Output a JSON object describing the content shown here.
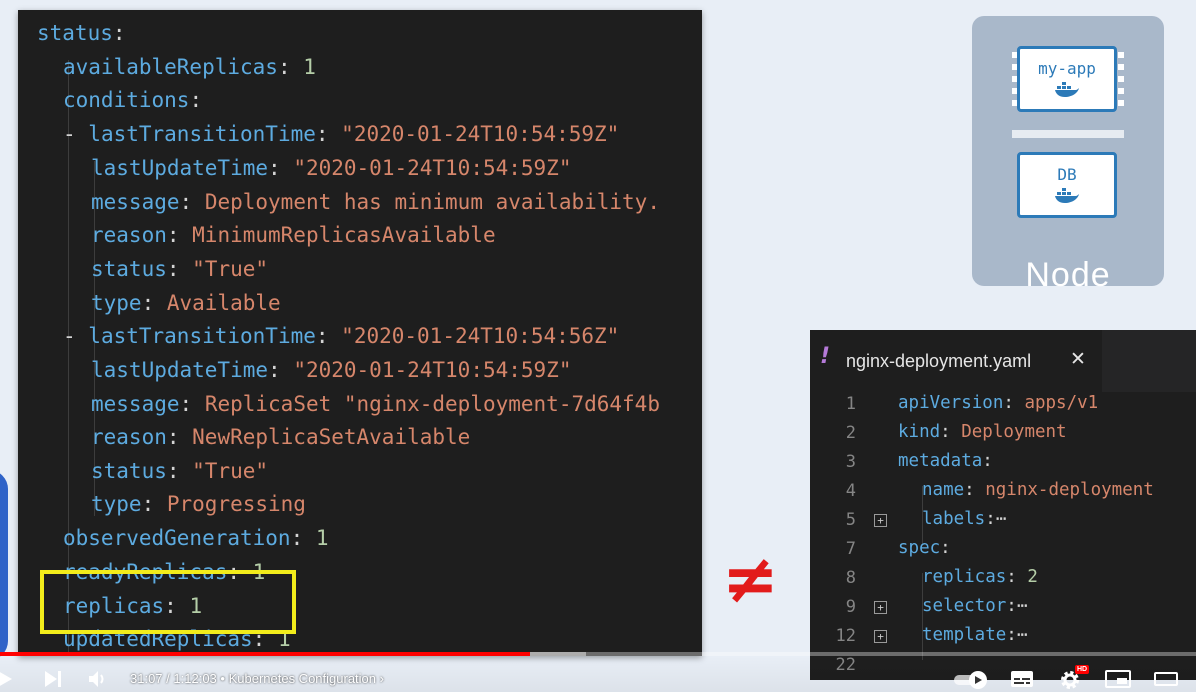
{
  "left_editor": {
    "lines": [
      {
        "t": [
          [
            "k",
            "status"
          ],
          [
            "p",
            ":"
          ]
        ]
      },
      {
        "t": [
          [
            "k",
            "availableReplicas"
          ],
          [
            "p",
            ": "
          ],
          [
            "n",
            "1"
          ]
        ]
      },
      {
        "t": [
          [
            "k",
            "conditions"
          ],
          [
            "p",
            ":"
          ]
        ]
      },
      {
        "t": [
          [
            "p",
            "- "
          ],
          [
            "k",
            "lastTransitionTime"
          ],
          [
            "p",
            ": "
          ],
          [
            "s",
            "\"2020-01-24T10:54:59Z\""
          ]
        ]
      },
      {
        "t": [
          [
            "k",
            "lastUpdateTime"
          ],
          [
            "p",
            ": "
          ],
          [
            "s",
            "\"2020-01-24T10:54:59Z\""
          ]
        ]
      },
      {
        "t": [
          [
            "k",
            "message"
          ],
          [
            "p",
            ": "
          ],
          [
            "s",
            "Deployment has minimum availability."
          ]
        ]
      },
      {
        "t": [
          [
            "k",
            "reason"
          ],
          [
            "p",
            ": "
          ],
          [
            "s",
            "MinimumReplicasAvailable"
          ]
        ]
      },
      {
        "t": [
          [
            "k",
            "status"
          ],
          [
            "p",
            ": "
          ],
          [
            "s",
            "\"True\""
          ]
        ]
      },
      {
        "t": [
          [
            "k",
            "type"
          ],
          [
            "p",
            ": "
          ],
          [
            "s",
            "Available"
          ]
        ]
      },
      {
        "t": [
          [
            "p",
            "- "
          ],
          [
            "k",
            "lastTransitionTime"
          ],
          [
            "p",
            ": "
          ],
          [
            "s",
            "\"2020-01-24T10:54:56Z\""
          ]
        ]
      },
      {
        "t": [
          [
            "k",
            "lastUpdateTime"
          ],
          [
            "p",
            ": "
          ],
          [
            "s",
            "\"2020-01-24T10:54:59Z\""
          ]
        ]
      },
      {
        "t": [
          [
            "k",
            "message"
          ],
          [
            "p",
            ": "
          ],
          [
            "s",
            "ReplicaSet \"nginx-deployment-7d64f4b"
          ]
        ]
      },
      {
        "t": [
          [
            "k",
            "reason"
          ],
          [
            "p",
            ": "
          ],
          [
            "s",
            "NewReplicaSetAvailable"
          ]
        ]
      },
      {
        "t": [
          [
            "k",
            "status"
          ],
          [
            "p",
            ": "
          ],
          [
            "s",
            "\"True\""
          ]
        ]
      },
      {
        "t": [
          [
            "k",
            "type"
          ],
          [
            "p",
            ": "
          ],
          [
            "s",
            "Progressing"
          ]
        ]
      },
      {
        "t": [
          [
            "k",
            "observedGeneration"
          ],
          [
            "p",
            ": "
          ],
          [
            "n",
            "1"
          ]
        ]
      },
      {
        "t": [
          [
            "k",
            "readyReplicas"
          ],
          [
            "p",
            ": "
          ],
          [
            "n",
            "1"
          ]
        ]
      },
      {
        "t": [
          [
            "k",
            "replicas"
          ],
          [
            "p",
            ": "
          ],
          [
            "n",
            "1"
          ]
        ]
      },
      {
        "t": [
          [
            "k",
            "updatedReplicas"
          ],
          [
            "p",
            ": "
          ],
          [
            "n",
            "1"
          ]
        ]
      }
    ]
  },
  "node": {
    "label": "Node",
    "containers": [
      {
        "name": "my-app",
        "icon": "docker-whale-icon"
      },
      {
        "name": "DB",
        "icon": "docker-whale-icon"
      }
    ]
  },
  "not_equal_symbol": "≠",
  "right_editor": {
    "tab_mark": "!",
    "tab_title": "nginx-deployment.yaml",
    "tab_close": "✕",
    "lines": [
      {
        "num": "1",
        "fold": false,
        "t": [
          [
            "k",
            "apiVersion"
          ],
          [
            "p",
            ": "
          ],
          [
            "s",
            "apps/v1"
          ]
        ]
      },
      {
        "num": "2",
        "fold": false,
        "t": [
          [
            "k",
            "kind"
          ],
          [
            "p",
            ": "
          ],
          [
            "s",
            "Deployment"
          ]
        ]
      },
      {
        "num": "3",
        "fold": false,
        "t": [
          [
            "k",
            "metadata"
          ],
          [
            "p",
            ":"
          ]
        ]
      },
      {
        "num": "4",
        "fold": false,
        "t": [
          [
            "k",
            "name"
          ],
          [
            "p",
            ": "
          ],
          [
            "s",
            "nginx-deployment"
          ]
        ]
      },
      {
        "num": "5",
        "fold": true,
        "t": [
          [
            "k",
            "labels"
          ],
          [
            "p",
            ":⋯"
          ]
        ]
      },
      {
        "num": "7",
        "fold": false,
        "t": [
          [
            "k",
            "spec"
          ],
          [
            "p",
            ":"
          ]
        ]
      },
      {
        "num": "8",
        "fold": false,
        "t": [
          [
            "k",
            "replicas"
          ],
          [
            "p",
            ": "
          ],
          [
            "n",
            "2"
          ]
        ]
      },
      {
        "num": "9",
        "fold": true,
        "t": [
          [
            "k",
            "selector"
          ],
          [
            "p",
            ":⋯"
          ]
        ]
      },
      {
        "num": "12",
        "fold": true,
        "t": [
          [
            "k",
            "template"
          ],
          [
            "p",
            ":⋯"
          ]
        ]
      },
      {
        "num": "22",
        "fold": false,
        "t": []
      }
    ]
  },
  "player": {
    "time_current": "31:07",
    "time_total": "1:12:03",
    "chapter": "Kubernetes Configuration",
    "progress": 0.443,
    "hd_badge": "HD"
  },
  "colors": {
    "key": "#5dabe0",
    "string": "#d6866b",
    "number": "#b5cea8",
    "highlight": "#f2ec1b",
    "progress": "#ff0000"
  }
}
